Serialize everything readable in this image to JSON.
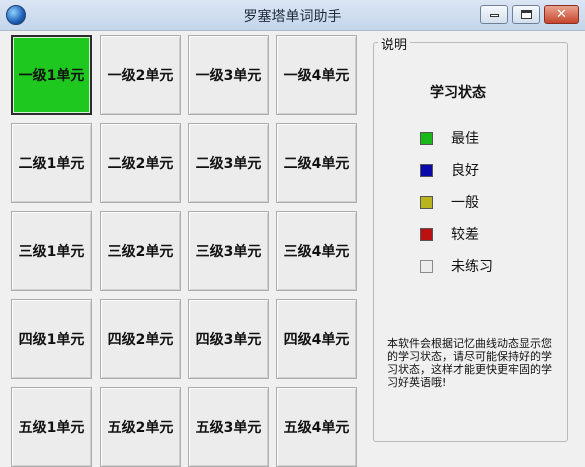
{
  "window": {
    "title": "罗塞塔单词助手",
    "icon": "globe-icon",
    "close_glyph": "✕"
  },
  "units": [
    [
      "一级1单元",
      "一级2单元",
      "一级3单元",
      "一级4单元"
    ],
    [
      "二级1单元",
      "二级2单元",
      "二级3单元",
      "二级4单元"
    ],
    [
      "三级1单元",
      "三级2单元",
      "三级3单元",
      "三级4单元"
    ],
    [
      "四级1单元",
      "四级2单元",
      "四级3单元",
      "四级4单元"
    ],
    [
      "五级1单元",
      "五级2单元",
      "五级3单元",
      "五级4单元"
    ]
  ],
  "unit_status": [
    [
      "best",
      "none",
      "none",
      "none"
    ],
    [
      "none",
      "none",
      "none",
      "none"
    ],
    [
      "none",
      "none",
      "none",
      "none"
    ],
    [
      "none",
      "none",
      "none",
      "none"
    ],
    [
      "none",
      "none",
      "none",
      "none"
    ]
  ],
  "legend": {
    "group_title": "说明",
    "heading": "学习状态",
    "items": [
      {
        "key": "best",
        "label": "最佳",
        "color": "#19b919"
      },
      {
        "key": "good",
        "label": "良好",
        "color": "#0a0aa8"
      },
      {
        "key": "fair",
        "label": "一般",
        "color": "#b8b41b"
      },
      {
        "key": "poor",
        "label": "较差",
        "color": "#bd1010"
      },
      {
        "key": "none",
        "label": "未练习",
        "color": "#ececec"
      }
    ],
    "note": "本软件会根据记忆曲线动态显示您的学习状态，请尽可能保持好的学习状态，这样才能更快更牢固的学习好英语哦!"
  }
}
